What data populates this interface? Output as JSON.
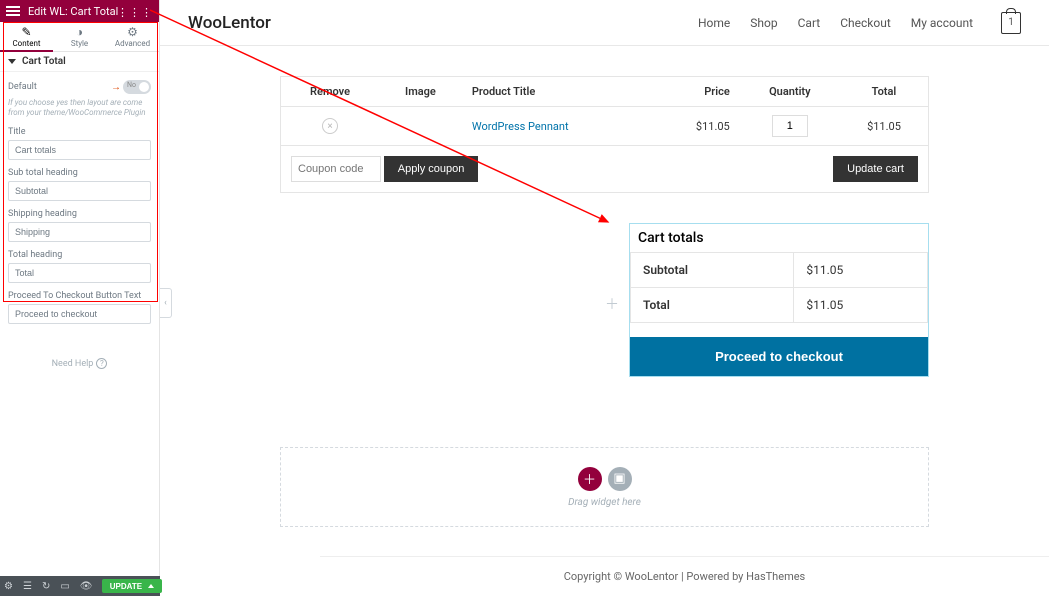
{
  "sidebar": {
    "title": "Edit WL: Cart Total",
    "tabs": {
      "content": "Content",
      "style": "Style",
      "advanced": "Advanced"
    },
    "section_title": "Cart Total",
    "default_label": "Default",
    "toggle_text": "No",
    "hint": "If you choose yes then layout are come from your theme/WooCommerce Plugin",
    "fields": {
      "title_label": "Title",
      "title_value": "Cart totals",
      "subtotal_label": "Sub total heading",
      "subtotal_value": "Subtotal",
      "shipping_label": "Shipping heading",
      "shipping_value": "Shipping",
      "total_label": "Total heading",
      "total_value": "Total",
      "checkout_label": "Proceed To Checkout Button Text",
      "checkout_value": "Proceed to checkout"
    },
    "need_help": "Need Help",
    "update": "UPDATE"
  },
  "store": {
    "logo": "WooLentor",
    "nav": {
      "home": "Home",
      "shop": "Shop",
      "cart": "Cart",
      "checkout": "Checkout",
      "account": "My account"
    },
    "bag_count": "1"
  },
  "cart": {
    "headers": {
      "remove": "Remove",
      "image": "Image",
      "title": "Product Title",
      "price": "Price",
      "qty": "Quantity",
      "total": "Total"
    },
    "row": {
      "product": "WordPress Pennant",
      "price": "$11.05",
      "qty": "1",
      "total": "$11.05"
    },
    "coupon_placeholder": "Coupon code",
    "apply": "Apply coupon",
    "update": "Update cart"
  },
  "totals": {
    "title": "Cart totals",
    "subtotal_label": "Subtotal",
    "subtotal": "$11.05",
    "total_label": "Total",
    "total": "$11.05",
    "checkout": "Proceed to checkout"
  },
  "dropzone": {
    "text": "Drag widget here"
  },
  "footer": "Copyright © WooLentor | Powered by HasThemes"
}
